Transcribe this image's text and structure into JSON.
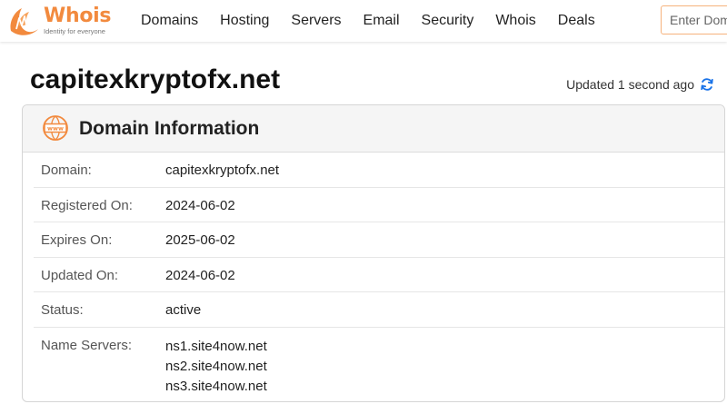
{
  "header": {
    "logo_word": "Whois",
    "logo_tagline": "Identity for everyone",
    "nav": [
      "Domains",
      "Hosting",
      "Servers",
      "Email",
      "Security",
      "Whois",
      "Deals"
    ],
    "search_placeholder": "Enter Domain"
  },
  "page": {
    "domain": "capitexkryptofx.net",
    "updated_text": "Updated 1 second ago"
  },
  "card": {
    "icon_text": "www",
    "title": "Domain Information",
    "rows": [
      {
        "label": "Domain:",
        "value": "capitexkryptofx.net"
      },
      {
        "label": "Registered On:",
        "value": "2024-06-02"
      },
      {
        "label": "Expires On:",
        "value": "2025-06-02"
      },
      {
        "label": "Updated On:",
        "value": "2024-06-02"
      },
      {
        "label": "Status:",
        "value": "active"
      }
    ],
    "name_servers_label": "Name Servers:",
    "name_servers": [
      "ns1.site4now.net",
      "ns2.site4now.net",
      "ns3.site4now.net"
    ]
  },
  "colors": {
    "brand": "#f28a3e",
    "search_border": "#f6b27c",
    "refresh_icon": "#1a73e8"
  },
  "icons": {
    "logo": "whois-logo-icon",
    "card": "www-globe-icon",
    "refresh": "refresh-icon"
  }
}
